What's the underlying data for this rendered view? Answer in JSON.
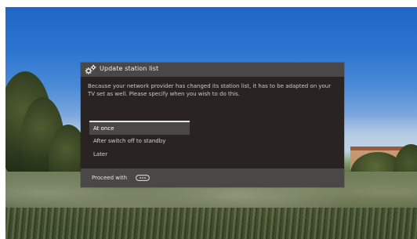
{
  "dialog": {
    "title": "Update station list",
    "message": "Because your network provider has changed its station list, it has to be adapted on your TV set as well. Please specify when you wish to do this.",
    "options": [
      {
        "label": "At once",
        "selected": true
      },
      {
        "label": "After switch off to standby",
        "selected": false
      },
      {
        "label": "Later",
        "selected": false
      }
    ],
    "footer": {
      "proceed_label": "Proceed with",
      "button_icon": "ok-remote-button-icon"
    },
    "header_icon": "gears-icon"
  },
  "colors": {
    "dialog_bg": "#292421",
    "header_bg": "#4b4746",
    "text": "#e7e3df"
  }
}
